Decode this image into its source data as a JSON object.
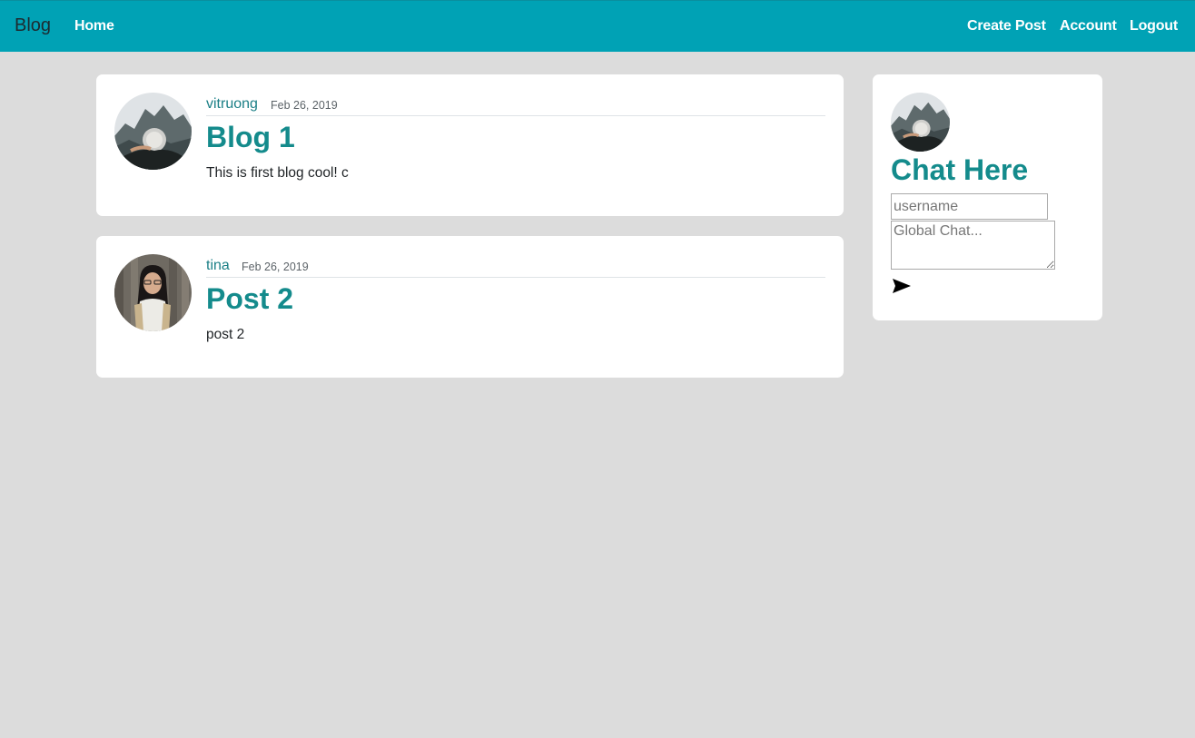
{
  "navbar": {
    "brand": "Blog",
    "home_label": "Home",
    "create_post_label": "Create Post",
    "account_label": "Account",
    "logout_label": "Logout",
    "background_color": "#00a2b5"
  },
  "posts": [
    {
      "author": "vitruong",
      "date": "Feb 26, 2019",
      "title": "Blog 1",
      "body": "This is first blog cool! c",
      "avatar": "rock-landscape-avatar"
    },
    {
      "author": "tina",
      "date": "Feb 26, 2019",
      "title": "Post 2",
      "body": "post 2",
      "avatar": "woman-portrait-avatar"
    }
  ],
  "chat": {
    "title": "Chat Here",
    "username_placeholder": "username",
    "username_value": "",
    "message_placeholder": "Global Chat...",
    "message_value": "",
    "send_icon": "send-arrow-icon",
    "avatar": "rock-landscape-avatar"
  },
  "colors": {
    "accent": "#148b8c",
    "page_background": "#dcdcdc",
    "card_background": "#ffffff"
  }
}
